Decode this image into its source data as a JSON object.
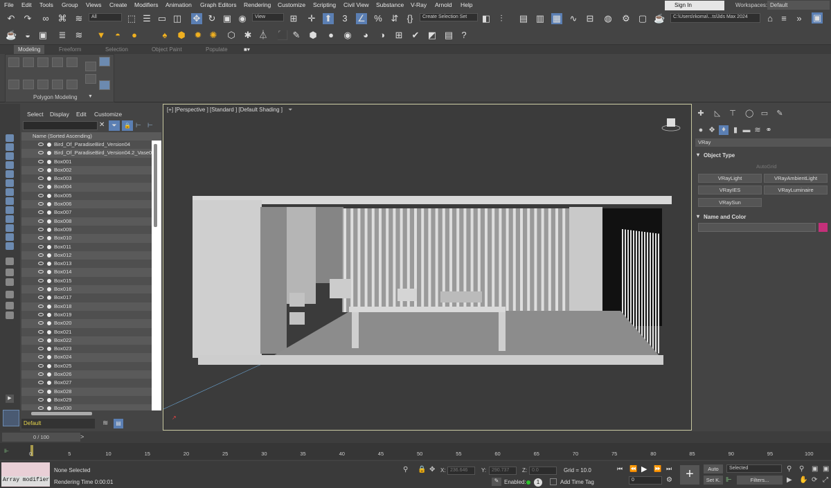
{
  "menu": [
    "File",
    "Edit",
    "Tools",
    "Group",
    "Views",
    "Create",
    "Modifiers",
    "Animation",
    "Graph Editors",
    "Rendering",
    "Customize",
    "Scripting",
    "Civil View",
    "Substance",
    "V-Ray",
    "Arnold",
    "Help"
  ],
  "signin": "Sign In",
  "workspaces_label": "Workspaces:",
  "workspace": "Default",
  "toolbar": {
    "filter": "All",
    "ref_coord": "View",
    "selection_set": "Create Selection Set",
    "project_path": "C:\\Users\\rkoma\\...ts\\3ds Max 2024"
  },
  "ribbon": {
    "tabs": [
      "Modeling",
      "Freeform",
      "Selection",
      "Object Paint",
      "Populate"
    ],
    "panel_title": "Polygon Modeling"
  },
  "scene_explorer": {
    "menu": [
      "Select",
      "Display",
      "Edit",
      "Customize"
    ],
    "header": "Name (Sorted Ascending)",
    "items": [
      "Bird_Of_ParadiseBird_Version04",
      "Bird_Of_ParadiseBird_Version04.2_Vase00",
      "Box001",
      "Box002",
      "Box003",
      "Box004",
      "Box005",
      "Box006",
      "Box007",
      "Box008",
      "Box009",
      "Box010",
      "Box011",
      "Box012",
      "Box013",
      "Box014",
      "Box015",
      "Box016",
      "Box017",
      "Box018",
      "Box019",
      "Box020",
      "Box021",
      "Box022",
      "Box023",
      "Box024",
      "Box025",
      "Box026",
      "Box027",
      "Box028",
      "Box029",
      "Box030"
    ],
    "layer": "Default"
  },
  "viewport": {
    "label": "[+] [Perspective ] [Standard ] [Default Shading ]"
  },
  "command_panel": {
    "category": "VRay",
    "rollout_object_type": "Object Type",
    "autogrid": "AutoGrid",
    "buttons": [
      "VRayLight",
      "VRayAmbientLight",
      "VRayIES",
      "VRayLuminaire",
      "VRaySun"
    ],
    "rollout_name_color": "Name and Color",
    "color_swatch": "#c4307a"
  },
  "timeline": {
    "frame": "0 / 100",
    "ticks": [
      "0",
      "5",
      "10",
      "15",
      "20",
      "25",
      "30",
      "35",
      "40",
      "45",
      "50",
      "55",
      "60",
      "65",
      "70",
      "75",
      "80",
      "85",
      "90",
      "95",
      "100"
    ]
  },
  "status": {
    "modifier": "Array modifier",
    "selected": "None Selected",
    "render_time": "Rendering Time  0:00:01",
    "x_label": "X:",
    "x_value": "236.646",
    "y_label": "Y:",
    "y_value": "290.737",
    "z_label": "Z:",
    "z_value": "0.0",
    "grid": "Grid = 10.0",
    "enabled": "Enabled:",
    "add_time_tag": "Add Time Tag",
    "auto": "Auto",
    "set_key": "Set K.",
    "selected_drop": "Selected",
    "filters": "Filters...",
    "frame_field": "0"
  }
}
